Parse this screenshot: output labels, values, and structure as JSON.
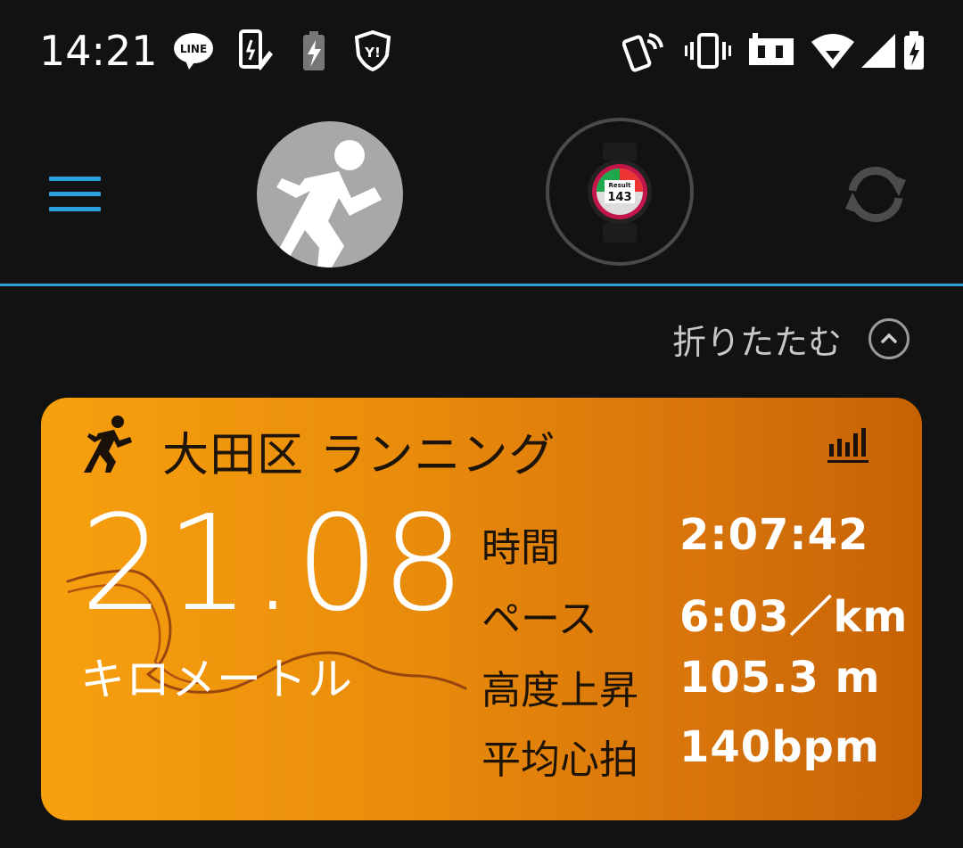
{
  "status_bar": {
    "time": "14:21",
    "left_icons": [
      "line-icon",
      "screenshot-icon",
      "battery-saver-icon",
      "yahoo-icon"
    ],
    "right_icons": [
      "nfc-icon",
      "vibrate-icon",
      "data-saver-icon",
      "wifi-icon",
      "signal-icon",
      "battery-icon"
    ]
  },
  "toolbar": {
    "menu_icon": "menu-icon",
    "profile_icon": "runner-avatar-icon",
    "device_icon": "watch-icon",
    "sync_icon": "sync-icon"
  },
  "collapse": {
    "label": "折りたたむ",
    "icon": "chevron-up-icon"
  },
  "activity": {
    "title": "大田区 ランニング",
    "distance": "21.08",
    "distance_unit": "キロメートル",
    "stats": [
      {
        "label": "時間",
        "value": "2:07:42"
      },
      {
        "label": "ペース",
        "value": "6:03／km"
      },
      {
        "label": "高度上昇",
        "value": "105.3 m"
      },
      {
        "label": "平均心拍",
        "value": "140bpm"
      }
    ],
    "colors": {
      "card_start": "#f7a00f",
      "card_end": "#c66204",
      "accent": "#2a9fd8"
    }
  }
}
